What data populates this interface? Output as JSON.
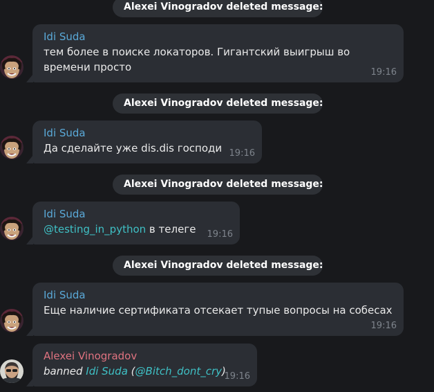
{
  "service_messages": [
    {
      "text": "Alexei Vinogradov deleted message:"
    },
    {
      "text": "Alexei Vinogradov deleted message:"
    },
    {
      "text": "Alexei Vinogradov deleted message:"
    },
    {
      "text": "Alexei Vinogradov deleted message:"
    }
  ],
  "messages": [
    {
      "author": "Idi Suda",
      "lines": [
        "тем более в поиске локаторов. Гигантский выигрыш во",
        "времени просто"
      ],
      "time": "19:16"
    },
    {
      "author": "Idi Suda",
      "text": "Да сделайте уже dis.dis господи",
      "time": "19:16"
    },
    {
      "author": "Idi Suda",
      "mention": "@testing_in_python",
      "text_after": " в телеге",
      "time": "19:16"
    },
    {
      "author": "Idi Suda",
      "text": "Еще наличие сертификата отсекает тупые вопросы на собесах",
      "time": "19:16"
    },
    {
      "author": "Alexei Vinogradov",
      "ban": {
        "action": "banned",
        "target_name": "Idi Suda",
        "open": "(",
        "handle": "@Bitch_dont_cry",
        "close": ")"
      },
      "time": "19:16"
    }
  ],
  "colors": {
    "background": "#18191c",
    "bubble": "#2b2e34",
    "service_pill": "#2e3136",
    "author_member": "#5aa9d8",
    "author_admin": "#e07380",
    "link": "#3fc0c5",
    "timestamp": "#7e848c"
  }
}
